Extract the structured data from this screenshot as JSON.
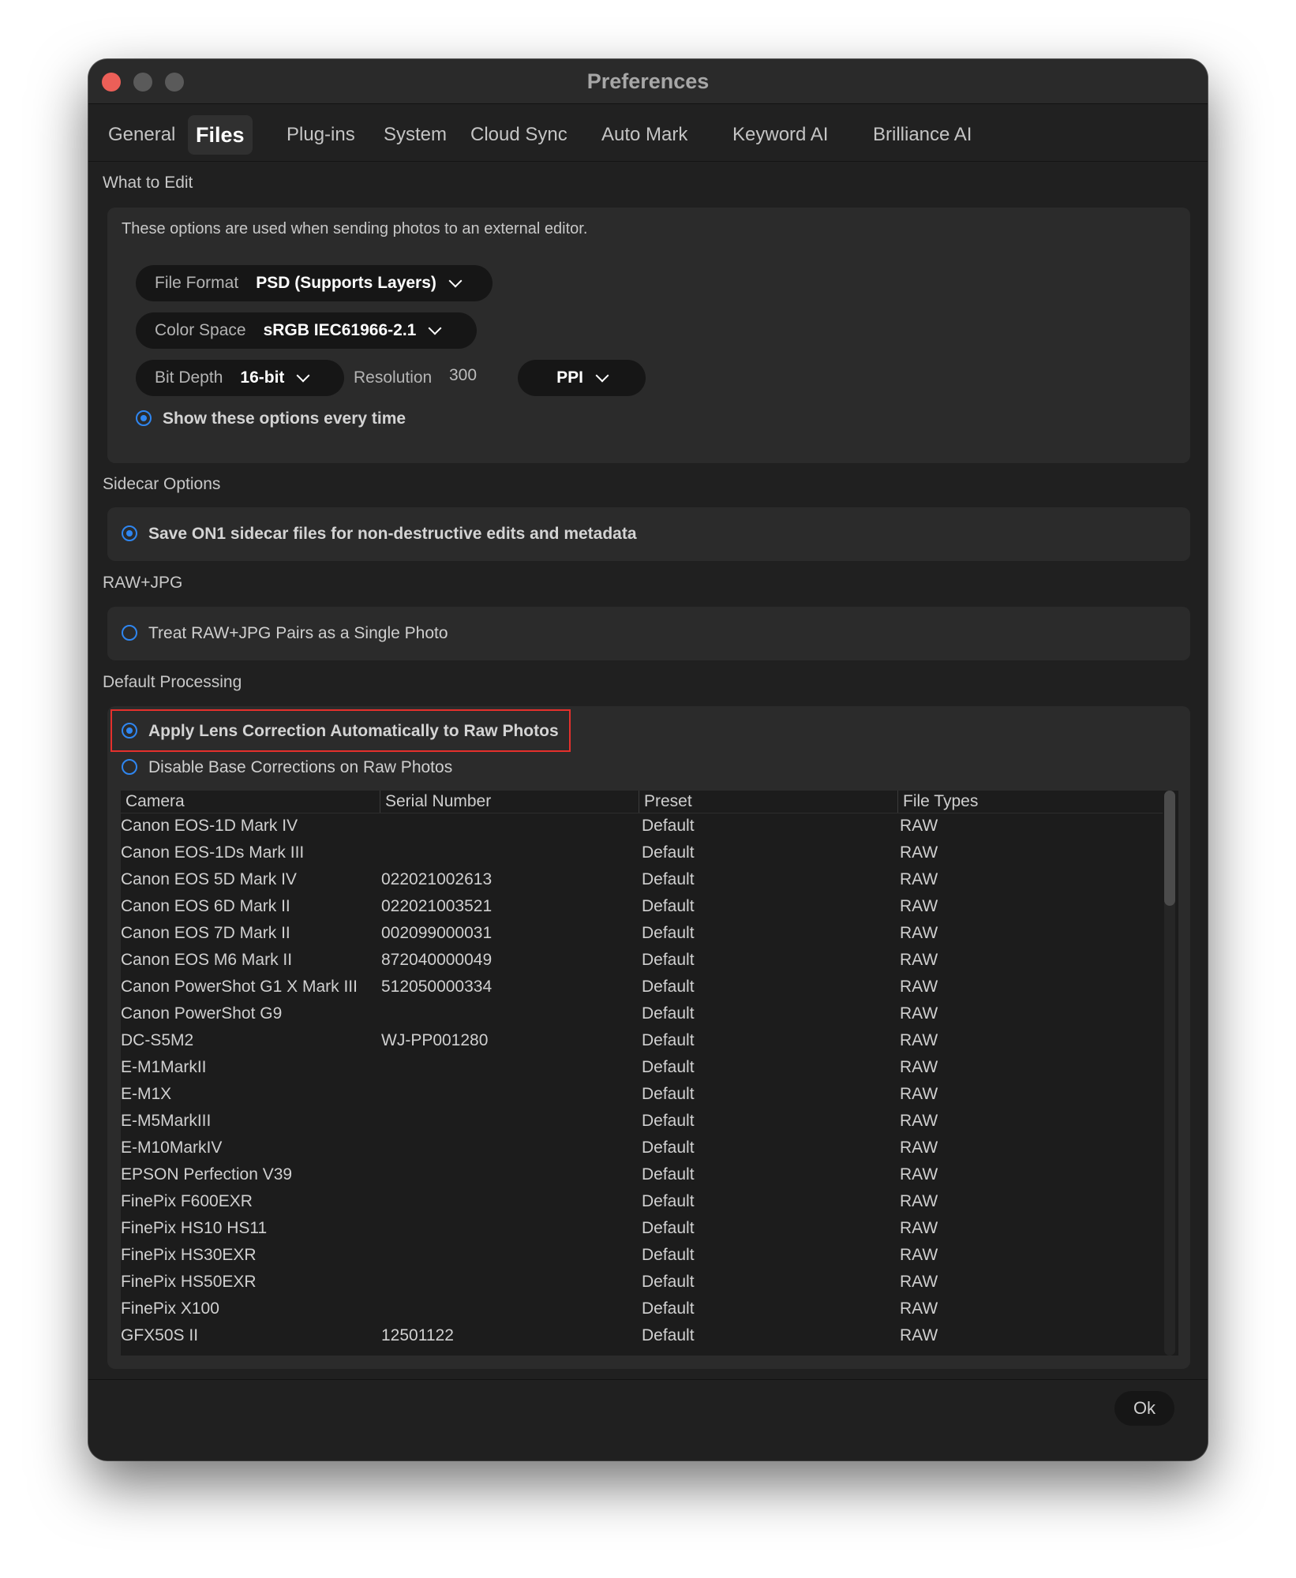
{
  "window": {
    "title": "Preferences"
  },
  "tabs": [
    {
      "label": "General"
    },
    {
      "label": "Files",
      "active": true
    },
    {
      "label": "Plug-ins"
    },
    {
      "label": "System"
    },
    {
      "label": "Cloud Sync"
    },
    {
      "label": "Auto Mark"
    },
    {
      "label": "Keyword AI"
    },
    {
      "label": "Brilliance AI"
    }
  ],
  "what_to_edit": {
    "heading": "What to Edit",
    "description": "These options are used when sending photos to an external editor.",
    "file_format": {
      "label": "File Format",
      "value": "PSD (Supports Layers)"
    },
    "color_space": {
      "label": "Color Space",
      "value": "sRGB IEC61966-2.1"
    },
    "bit_depth": {
      "label": "Bit Depth",
      "value": "16-bit"
    },
    "resolution": {
      "label": "Resolution",
      "value": "300",
      "unit": "PPI"
    },
    "show_options": {
      "label": "Show these options every time",
      "checked": true
    }
  },
  "sidecar": {
    "heading": "Sidecar Options",
    "save_sidecar": {
      "label": "Save ON1 sidecar files for non-destructive edits and metadata",
      "checked": true
    }
  },
  "raw_jpg": {
    "heading": "RAW+JPG",
    "treat_pairs": {
      "label": "Treat RAW+JPG Pairs as a Single Photo",
      "checked": false
    }
  },
  "default_processing": {
    "heading": "Default Processing",
    "lens_correction": {
      "label": "Apply Lens Correction Automatically to Raw Photos",
      "checked": true
    },
    "disable_base": {
      "label": "Disable Base Corrections on Raw Photos",
      "checked": false
    },
    "table": {
      "columns": [
        "Camera",
        "Serial Number",
        "Preset",
        "File Types"
      ],
      "rows": [
        [
          "Canon EOS-1D Mark IV",
          "",
          "Default",
          "RAW"
        ],
        [
          "Canon EOS-1Ds Mark III",
          "",
          "Default",
          "RAW"
        ],
        [
          "Canon EOS 5D Mark IV",
          "022021002613",
          "Default",
          "RAW"
        ],
        [
          "Canon EOS 6D Mark II",
          "022021003521",
          "Default",
          "RAW"
        ],
        [
          "Canon EOS 7D Mark II",
          "002099000031",
          "Default",
          "RAW"
        ],
        [
          "Canon EOS M6 Mark II",
          "872040000049",
          "Default",
          "RAW"
        ],
        [
          "Canon PowerShot G1 X Mark III",
          "512050000334",
          "Default",
          "RAW"
        ],
        [
          "Canon PowerShot G9",
          "",
          "Default",
          "RAW"
        ],
        [
          "DC-S5M2",
          "WJ-PP001280",
          "Default",
          "RAW"
        ],
        [
          "E-M1MarkII",
          "",
          "Default",
          "RAW"
        ],
        [
          "E-M1X",
          "",
          "Default",
          "RAW"
        ],
        [
          "E-M5MarkIII",
          "",
          "Default",
          "RAW"
        ],
        [
          "E-M10MarkIV",
          "",
          "Default",
          "RAW"
        ],
        [
          "EPSON Perfection V39",
          "",
          "Default",
          "RAW"
        ],
        [
          "FinePix F600EXR",
          "",
          "Default",
          "RAW"
        ],
        [
          "FinePix HS10 HS11",
          "",
          "Default",
          "RAW"
        ],
        [
          "FinePix HS30EXR",
          "",
          "Default",
          "RAW"
        ],
        [
          "FinePix HS50EXR",
          "",
          "Default",
          "RAW"
        ],
        [
          "FinePix X100",
          "",
          "Default",
          "RAW"
        ],
        [
          "GFX50S II",
          "12501122",
          "Default",
          "RAW"
        ]
      ]
    }
  },
  "footer": {
    "ok_label": "Ok"
  },
  "colors": {
    "accent": "#2f86f0",
    "highlight": "#e5302c",
    "close": "#ec5f58"
  }
}
